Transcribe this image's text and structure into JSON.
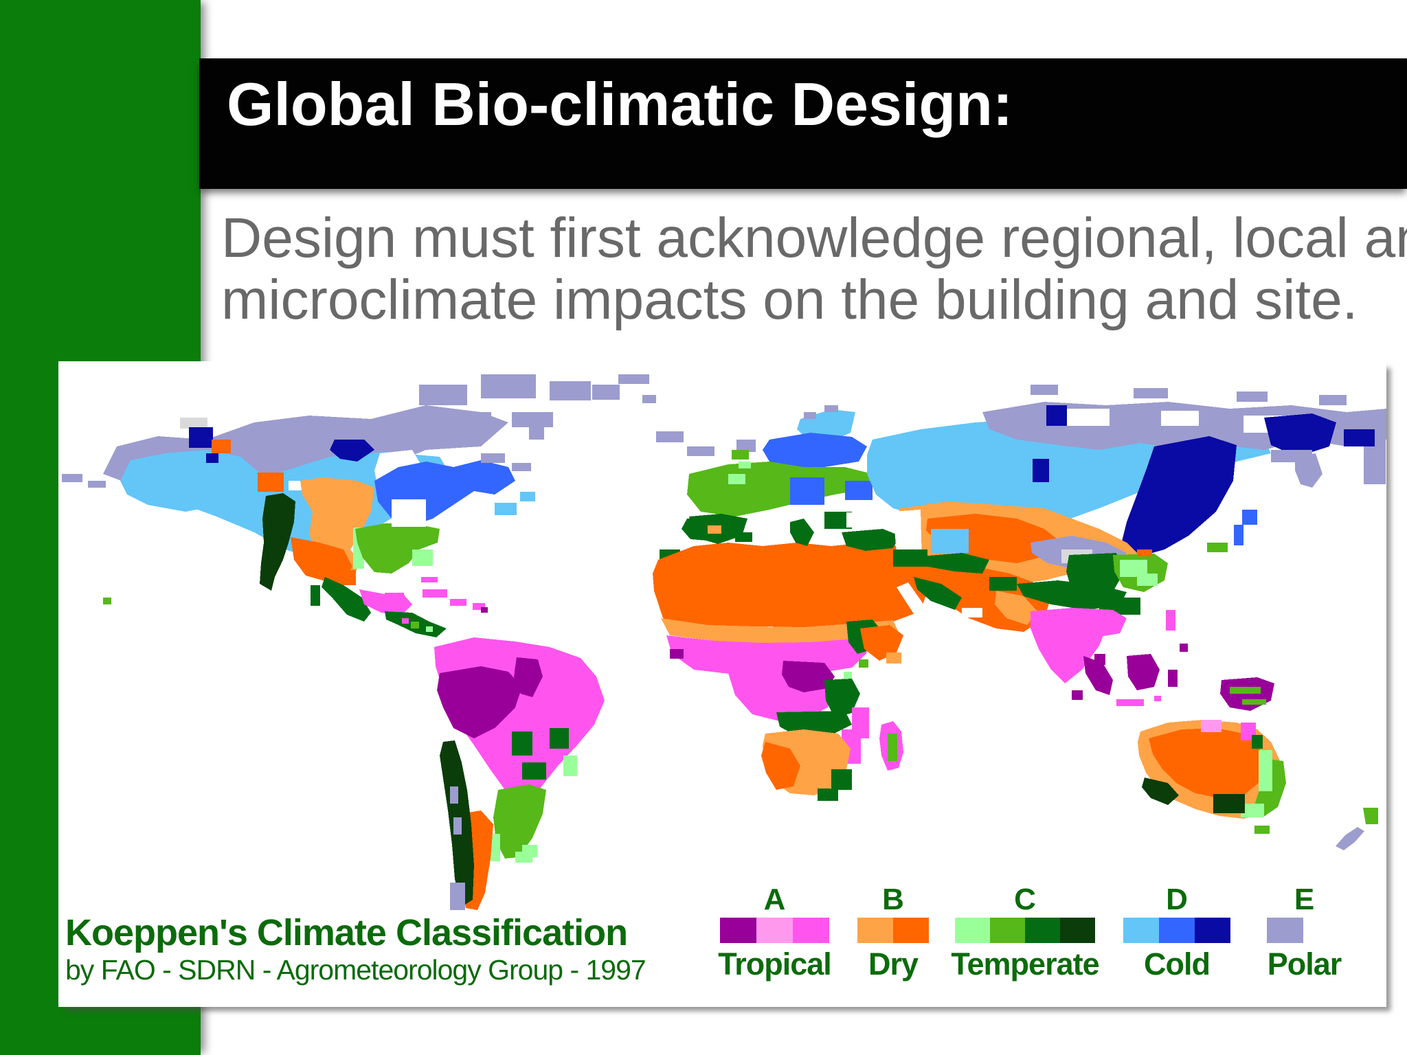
{
  "slide": {
    "title": "Global Bio-climatic Design:",
    "body_lines": [
      "Design must first acknowledge regional, local and",
      "microclimate impacts on the building and site."
    ]
  },
  "map_figure": {
    "title": "Koeppen's Climate Classification",
    "credit": "by FAO - SDRN - Agrometeorology Group - 1997",
    "legend": {
      "groups": [
        {
          "code": "A",
          "label": "Tropical",
          "colors": [
            "#990099",
            "#FF99EE",
            "#FF55EE"
          ]
        },
        {
          "code": "B",
          "label": "Dry",
          "colors": [
            "#FFA347",
            "#FF6600"
          ]
        },
        {
          "code": "C",
          "label": "Temperate",
          "colors": [
            "#99FF99",
            "#56B819",
            "#046D14",
            "#0A3D0A"
          ]
        },
        {
          "code": "D",
          "label": "Cold",
          "colors": [
            "#63C6F7",
            "#3366FF",
            "#0A0AA5"
          ]
        },
        {
          "code": "E",
          "label": "Polar",
          "colors": [
            "#9C9CCE"
          ]
        }
      ],
      "text_color": "#0b6b0b"
    }
  },
  "theme": {
    "sidebar_green": "#0a7d0a",
    "title_bar_background": "#020202",
    "title_text_color": "#ffffff",
    "body_text_color": "#696969"
  }
}
